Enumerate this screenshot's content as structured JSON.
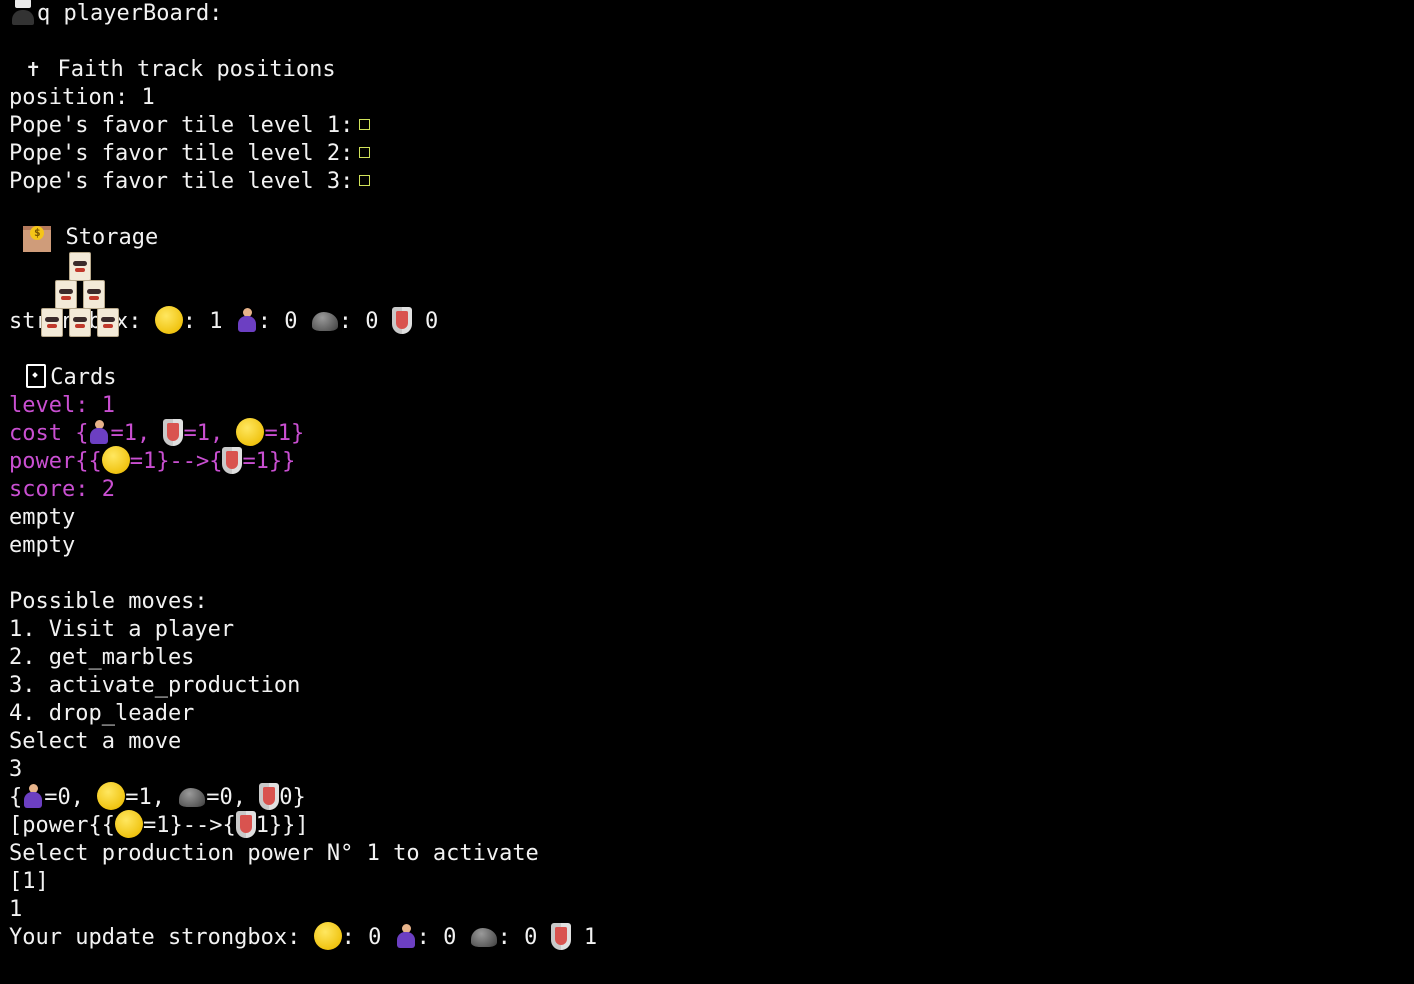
{
  "header": {
    "cmd": "q playerBoard:"
  },
  "faith": {
    "title": "Faith track positions",
    "position_line": "position: 1",
    "tiles": [
      "Pope's favor tile level 1:",
      "Pope's favor tile level 2:",
      "Pope's favor tile level 3:"
    ]
  },
  "storage": {
    "title": "Storage",
    "strongbox_label": "strongbox:",
    "strongbox_values": {
      "coin": ": 1",
      "servant": ": 0",
      "stone": ": 0",
      "shield": " 0"
    }
  },
  "cards": {
    "title": "Cards",
    "level": "level: 1",
    "cost_prefix": "cost {",
    "cost_servant": "=1, ",
    "cost_shield": "=1, ",
    "cost_coin": "=1}",
    "power_prefix": "power{{",
    "power_coin": "=1}-->{",
    "power_shield": "=1}}",
    "score": "score: 2",
    "slots": [
      "empty",
      "empty"
    ]
  },
  "moves": {
    "title": "Possible moves:",
    "items": [
      "1. Visit a player",
      "2. get_marbles",
      "3. activate_production",
      "4. drop_leader"
    ],
    "prompt": "Select a move",
    "input": "3"
  },
  "resources_line": {
    "prefix": "{",
    "servant": "=0, ",
    "coin": "=1, ",
    "stone": "=0, ",
    "shield": "0}"
  },
  "power_list_line": {
    "prefix": "[power{{",
    "coin": "=1}-->{",
    "shield": "1}}]"
  },
  "production": {
    "prompt": "Select production power N° 1 to activate",
    "options": "[1]",
    "input": "1"
  },
  "update": {
    "label": "Your update strongbox:",
    "coin": ": 0",
    "servant": ": 0",
    "stone": ": 0",
    "shield": " 1"
  }
}
